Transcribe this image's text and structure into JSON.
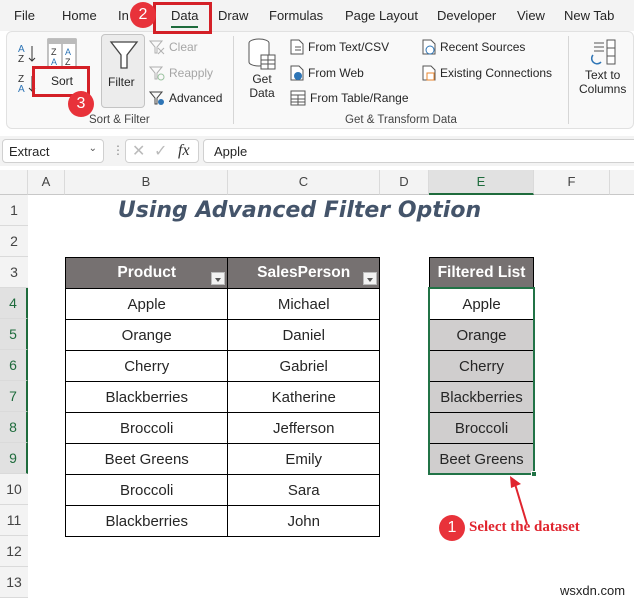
{
  "menubar": {
    "tabs": [
      "File",
      "Home",
      "In",
      "Data",
      "Draw",
      "Formulas",
      "Page Layout",
      "Developer",
      "View",
      "New Tab"
    ],
    "active_tab": "Data"
  },
  "ribbon": {
    "sort_filter": {
      "sort_az_icon": "sort-a-to-z-icon",
      "sort_za_icon": "sort-z-to-a-icon",
      "sort_label": "Sort",
      "filter_label": "Filter",
      "clear_label": "Clear",
      "reapply_label": "Reapply",
      "advanced_label": "Advanced",
      "group_label": "Sort & Filter"
    },
    "get_transform": {
      "get_data_label_1": "Get",
      "get_data_label_2": "Data",
      "from_text_csv": "From Text/CSV",
      "from_web": "From Web",
      "from_table_range": "From Table/Range",
      "recent_sources": "Recent Sources",
      "existing_connections": "Existing Connections",
      "group_label": "Get & Transform Data"
    },
    "data_tools": {
      "text_to_columns_1": "Text to",
      "text_to_columns_2": "Columns"
    }
  },
  "formula_bar": {
    "name_box": "Extract",
    "fx_label": "fx",
    "value": "Apple"
  },
  "grid": {
    "columns": [
      "A",
      "B",
      "C",
      "D",
      "E",
      "F"
    ],
    "selected_column": "E",
    "rows": [
      "1",
      "2",
      "3",
      "4",
      "5",
      "6",
      "7",
      "8",
      "9",
      "10",
      "11",
      "12",
      "13"
    ],
    "selected_rows": [
      "4",
      "5",
      "6",
      "7",
      "8",
      "9"
    ]
  },
  "sheet": {
    "title": "Using Advanced Filter Option",
    "table": {
      "headers": [
        "Product",
        "SalesPerson"
      ],
      "rows": [
        [
          "Apple",
          "Michael"
        ],
        [
          "Orange",
          "Daniel"
        ],
        [
          "Cherry",
          "Gabriel"
        ],
        [
          "Blackberries",
          "Katherine"
        ],
        [
          "Broccoli",
          "Jefferson"
        ],
        [
          "Beet Greens",
          "Emily"
        ],
        [
          "Broccoli",
          "Sara"
        ],
        [
          "Blackberries",
          "John"
        ]
      ]
    },
    "filtered_list": {
      "header": "Filtered List",
      "items": [
        "Apple",
        "Orange",
        "Cherry",
        "Blackberries",
        "Broccoli",
        "Beet Greens"
      ]
    }
  },
  "annotations": {
    "step1_number": "1",
    "step1_text": "Select the dataset",
    "step2_number": "2",
    "step3_number": "3",
    "color": "#e0242e"
  },
  "watermark": "wsxdn.com"
}
